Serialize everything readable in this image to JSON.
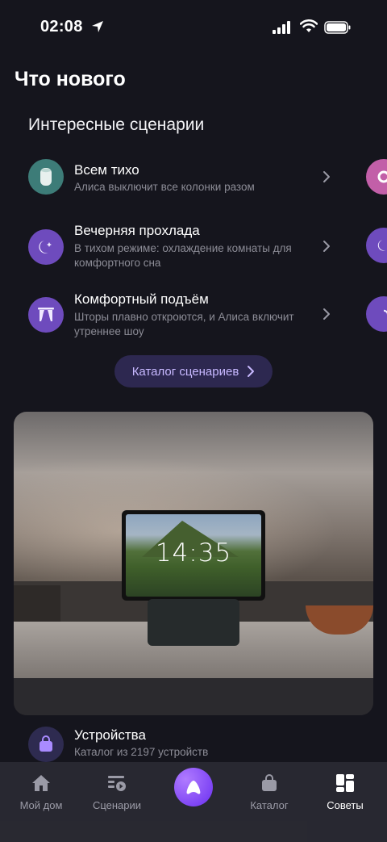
{
  "status_bar": {
    "time": "02:08"
  },
  "page": {
    "title": "Что нового"
  },
  "scenarios_section": {
    "title": "Интересные сценарии",
    "items": [
      {
        "title": "Всем тихо",
        "subtitle": "Алиса выключит все колонки разом",
        "icon": "speaker-icon",
        "color": "#3d7c78"
      },
      {
        "title": "Вечерняя прохлада",
        "subtitle": "В тихом режиме: охлаждение комнаты для комфортного сна",
        "icon": "moon-icon",
        "color": "#6e4bbd"
      },
      {
        "title": "Комфортный подъём",
        "subtitle": "Шторы плавно откроются, и Алиса включит утреннее шоу",
        "icon": "curtains-icon",
        "color": "#6e4bbd"
      }
    ],
    "catalog_button": "Каталог сценариев"
  },
  "promo": {
    "clock": "14:35"
  },
  "devices": {
    "title": "Устройства",
    "subtitle": "Каталог из 2197 устройств"
  },
  "tab_bar": {
    "tabs": [
      {
        "label": "Мой дом",
        "icon": "home-icon"
      },
      {
        "label": "Сценарии",
        "icon": "scenarios-icon"
      },
      {
        "label": "",
        "icon": "alice-icon"
      },
      {
        "label": "Каталог",
        "icon": "bag-icon"
      },
      {
        "label": "Советы",
        "icon": "tips-grid-icon",
        "active": true
      }
    ]
  },
  "colors": {
    "background": "#15151d",
    "accent": "#c7b8ff",
    "purple": "#6e4bbd",
    "teal": "#3d7c78"
  }
}
